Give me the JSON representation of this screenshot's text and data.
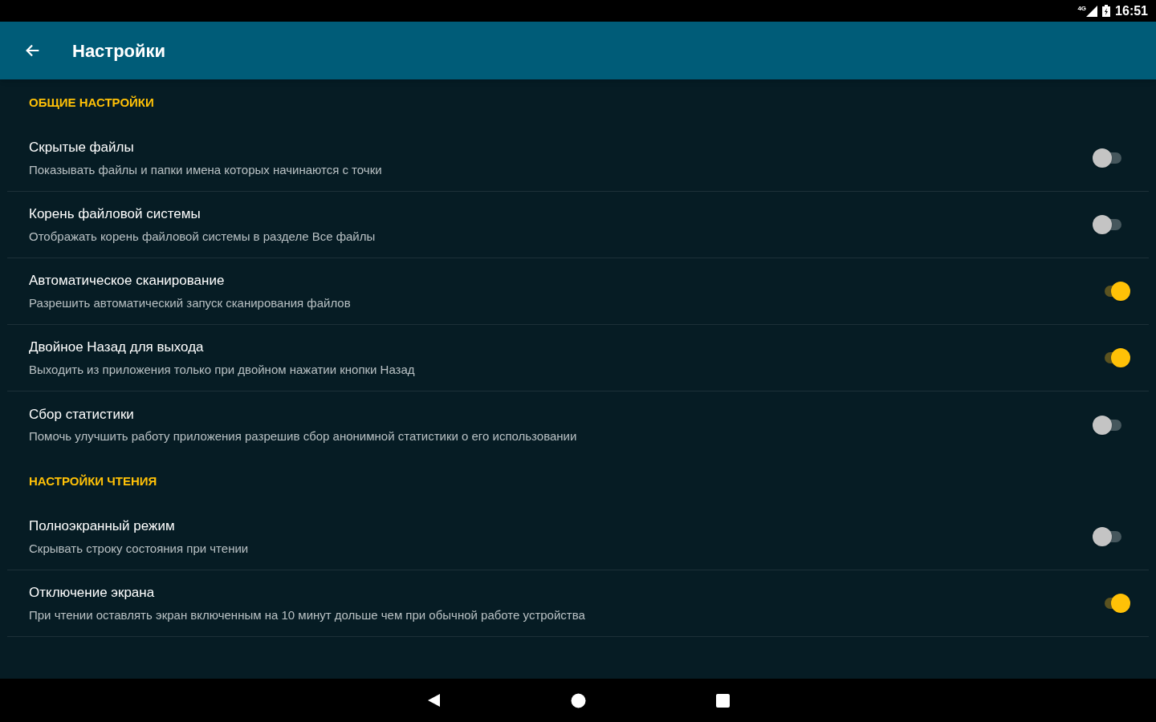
{
  "status_bar": {
    "network": "4G",
    "time": "16:51"
  },
  "app_bar": {
    "title": "Настройки"
  },
  "sections": [
    {
      "title": "ОБЩИЕ НАСТРОЙКИ",
      "items": [
        {
          "title": "Скрытые файлы",
          "summary": "Показывать файлы и папки имена которых начинаются с точки",
          "on": false
        },
        {
          "title": "Корень файловой системы",
          "summary": "Отображать корень файловой системы в разделе Все файлы",
          "on": false
        },
        {
          "title": "Автоматическое сканирование",
          "summary": "Разрешить автоматический запуск сканирования файлов",
          "on": true
        },
        {
          "title": "Двойное Назад для выхода",
          "summary": "Выходить из приложения только при двойном нажатии кнопки Назад",
          "on": true
        },
        {
          "title": "Сбор статистики",
          "summary": "Помочь улучшить работу приложения разрешив сбор анонимной статистики о его использовании",
          "on": false
        }
      ]
    },
    {
      "title": "НАСТРОЙКИ ЧТЕНИЯ",
      "items": [
        {
          "title": "Полноэкранный режим",
          "summary": "Скрывать строку состояния при чтении",
          "on": false
        },
        {
          "title": "Отключение экрана",
          "summary": "При чтении оставлять экран включенным на 10 минут дольше чем при обычной работе устройства",
          "on": true
        }
      ]
    }
  ]
}
